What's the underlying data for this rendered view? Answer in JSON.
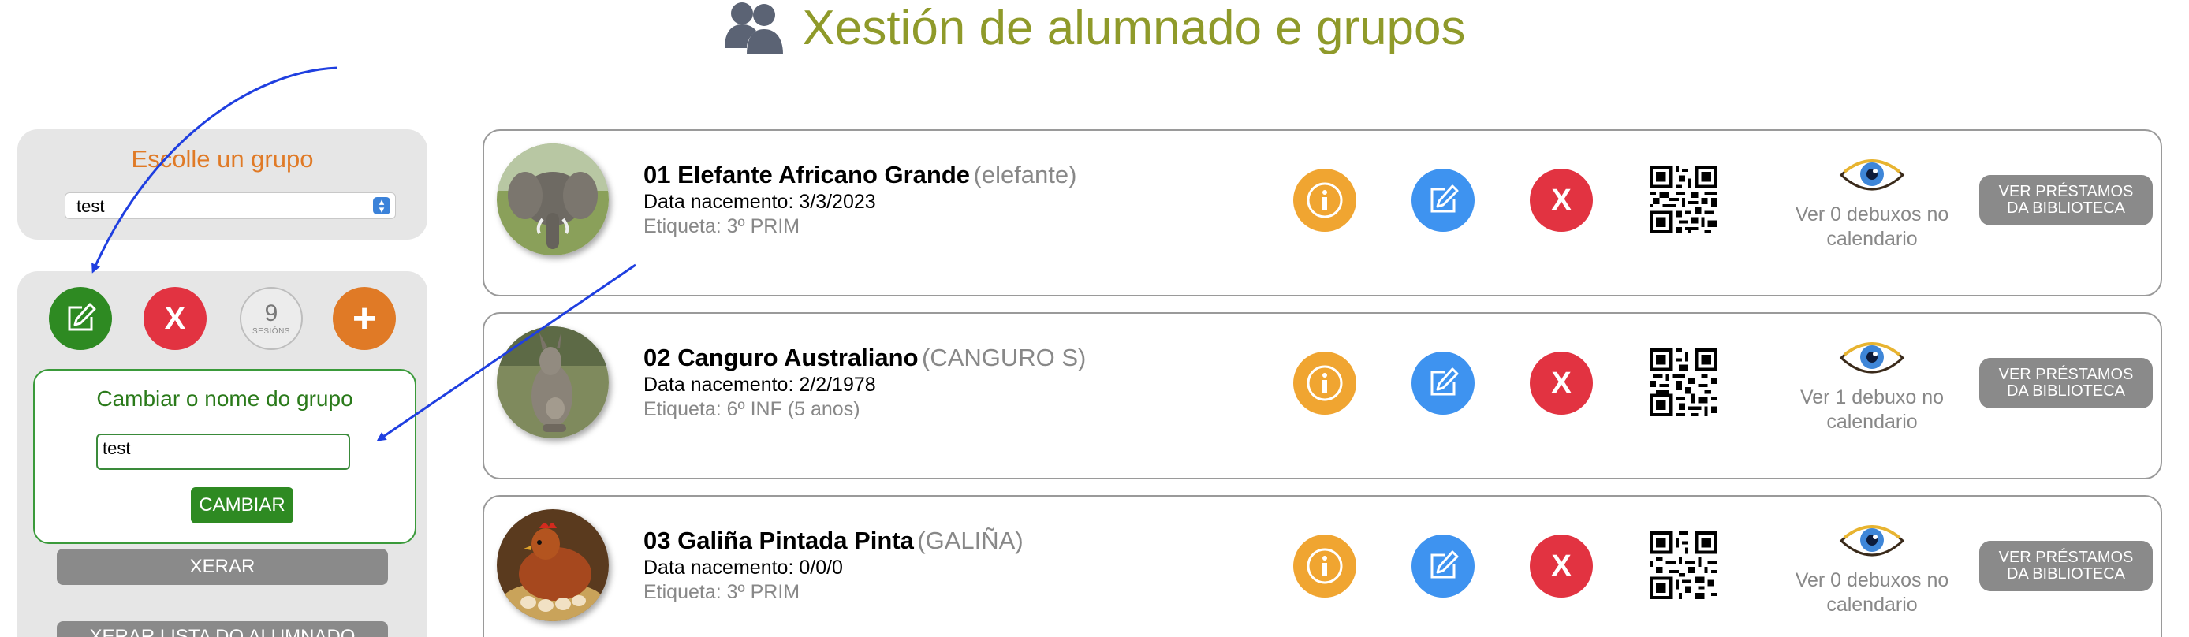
{
  "header": {
    "title": "Xestión de alumnado e grupos",
    "icon": "users-icon"
  },
  "sidebar": {
    "group_panel": {
      "title": "Escolle un grupo",
      "selected_group": "test"
    },
    "actions": {
      "sessions_count": "9",
      "sessions_label": "SESIÓNS"
    },
    "rename": {
      "title": "Cambiar o nome do grupo",
      "input_value": "test",
      "submit_label": "CAMBIAR"
    },
    "generate_label": "XERAR",
    "generate_list_label": "XERAR LISTA DO ALUMNADO"
  },
  "students": [
    {
      "name": "01 Elefante Africano Grande",
      "alias": "(elefante)",
      "birth": "Data nacemento: 3/3/2023",
      "tag": "Etiqueta: 3º PRIM",
      "drawings": "Ver 0 debuxos no calendario",
      "library_label": "VER PRÉSTAMOS DA BIBLIOTECA"
    },
    {
      "name": "02 Canguro Australiano",
      "alias": "(CANGURO S)",
      "birth": "Data nacemento: 2/2/1978",
      "tag": "Etiqueta: 6º INF (5 anos)",
      "drawings": "Ver 1 debuxo no calendario",
      "library_label": "VER PRÉSTAMOS DA BIBLIOTECA"
    },
    {
      "name": "03 Galiña Pintada Pinta",
      "alias": "(GALIÑA)",
      "birth": "Data nacemento: 0/0/0",
      "tag": "Etiqueta: 3º PRIM",
      "drawings": "Ver 0 debuxos no calendario",
      "library_label": "VER PRÉSTAMOS DA BIBLIOTECA"
    }
  ],
  "colors": {
    "title": "#8f9a2a",
    "orange": "#e07a26",
    "green": "#2e8a22",
    "red": "#e23341",
    "info_yellow": "#f0a531",
    "edit_blue": "#3e93f0",
    "grey_button": "#8a8a8a",
    "annotation_arrow": "#1f3fe0"
  }
}
